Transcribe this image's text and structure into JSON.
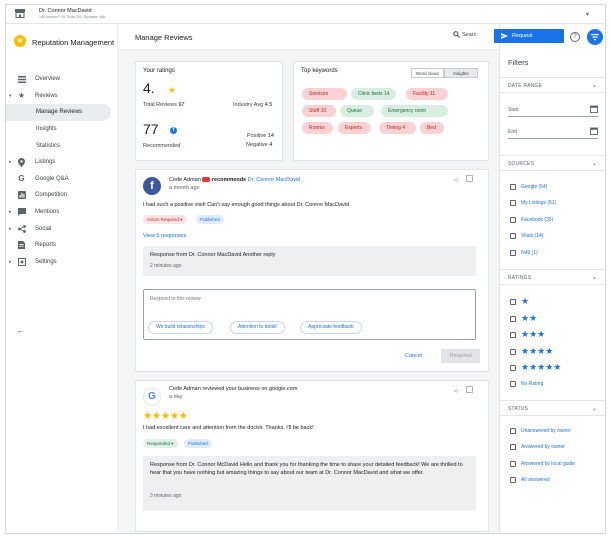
{
  "location": {
    "name": "Dr. Connor MacDavid",
    "address": "148 Avenue P St. Suite 200, Spokane, WA",
    "store_label": "Menu"
  },
  "brand": {
    "name": "Reputation Management",
    "accent": "#fbbc04"
  },
  "nav": {
    "items": [
      {
        "label": "Overview",
        "icon": "dashboard-icon"
      },
      {
        "label": "Reviews",
        "icon": "star-icon"
      },
      {
        "label": "Manage Reviews"
      },
      {
        "label": "Insights"
      },
      {
        "label": "Statistics"
      },
      {
        "label": "Listings",
        "icon": "pin-icon"
      },
      {
        "label": "Google Q&A",
        "icon": "google-icon"
      },
      {
        "label": "Competition",
        "icon": "chart-icon"
      },
      {
        "label": "Mentions",
        "icon": "chat-icon"
      },
      {
        "label": "Social",
        "icon": "share-icon"
      },
      {
        "label": "Reports",
        "icon": "document-icon"
      },
      {
        "label": "Settings",
        "icon": "settings-icon"
      }
    ]
  },
  "header": {
    "title": "Manage Reviews",
    "search_label": "Searc"
  },
  "ratings": {
    "title": "Your ratings",
    "average": "4.",
    "total_label": "Total Reviews",
    "total": "97",
    "industry_label": "Industry Avg",
    "industry_avg": "4.5",
    "recommended_count": "77",
    "recommended_label": "Recommended",
    "positive_label": "Positive",
    "positive": "14",
    "negative_label": "Negative",
    "negative": "4"
  },
  "keywords": {
    "title": "Top keywords",
    "toggle_word_cloud": "Word cloud",
    "toggle_insights": "Insights",
    "items": [
      {
        "label": "Services",
        "tone": "red"
      },
      {
        "label": "Clinic beds 14",
        "tone": "green"
      },
      {
        "label": "Facility 11",
        "tone": "red"
      },
      {
        "label": "Staff 10",
        "tone": "red"
      },
      {
        "label": "Queue",
        "tone": "green"
      },
      {
        "label": "Emergency room",
        "tone": "green"
      },
      {
        "label": "Rooms",
        "tone": "red"
      },
      {
        "label": "Experts",
        "tone": "red"
      },
      {
        "label": "Timing 4",
        "tone": "red"
      },
      {
        "label": "Bed",
        "tone": "red"
      }
    ]
  },
  "review1": {
    "author": "Cede Adman",
    "verb": "recommends",
    "target": "Dr. Connor MacDavid",
    "time": "a month ago",
    "text": "I had such a positive visit! Can't say enough good things about Dr. Connor MacDavid",
    "status_action": "Action Required",
    "status_published": "Published",
    "view_responses": "View 5 responses",
    "response_text": "Response from Dr. Connor MacDavid Another reply",
    "response_time": "2 minutes ago",
    "reply_placeholder": "Respond to this review",
    "suggestions": [
      "We build relationships",
      "Attention to detail",
      "Appreciate feedback"
    ],
    "cancel": "Cancel",
    "respond": "Respond"
  },
  "review2": {
    "author_line": "Cede Adman reviewed your business on google.com",
    "time": "a day",
    "rating": 5,
    "text": "I had excellent care and attention from the doctor. Thanks, I'll be back!",
    "status_responded": "Responded",
    "status_published": "Published",
    "response_text": "Response from Dr. Connor McDavid Hello and thank you for thanking the time to share your detailed feedback! We are thrilled to hear that you have nothing but amazing things to say about our team at Dr. Connor MacDavid and what we offer.",
    "response_time": "3 minutes ago"
  },
  "request_button": {
    "label": "Request"
  },
  "filters": {
    "title": "Filters",
    "date_range": "DATE RANGE",
    "start": "Start",
    "end": "End",
    "sources_title": "SOURCES",
    "sources": [
      "Google (54)",
      "My Listings (51)",
      "Facebook (33)",
      "Vitals (14)",
      "N49 (1)"
    ],
    "ratings_title": "RATINGS",
    "ratings": [
      {
        "label": "★",
        "stars": 1
      },
      {
        "label": "★★",
        "stars": 2
      },
      {
        "label": "★★★",
        "stars": 3
      },
      {
        "label": "★★★★",
        "stars": 4
      },
      {
        "label": "★★★★★",
        "stars": 5
      },
      {
        "label": "No Rating",
        "stars": 0
      }
    ],
    "status_title": "STATUS",
    "statuses": [
      "Unanswered by owner",
      "Answered by owner",
      "Answered by local guide",
      "All answered"
    ]
  },
  "colors": {
    "primary": "#1a73e8",
    "star": "#fbbc04",
    "danger": "#c5221f",
    "success": "#1e6b3a"
  }
}
